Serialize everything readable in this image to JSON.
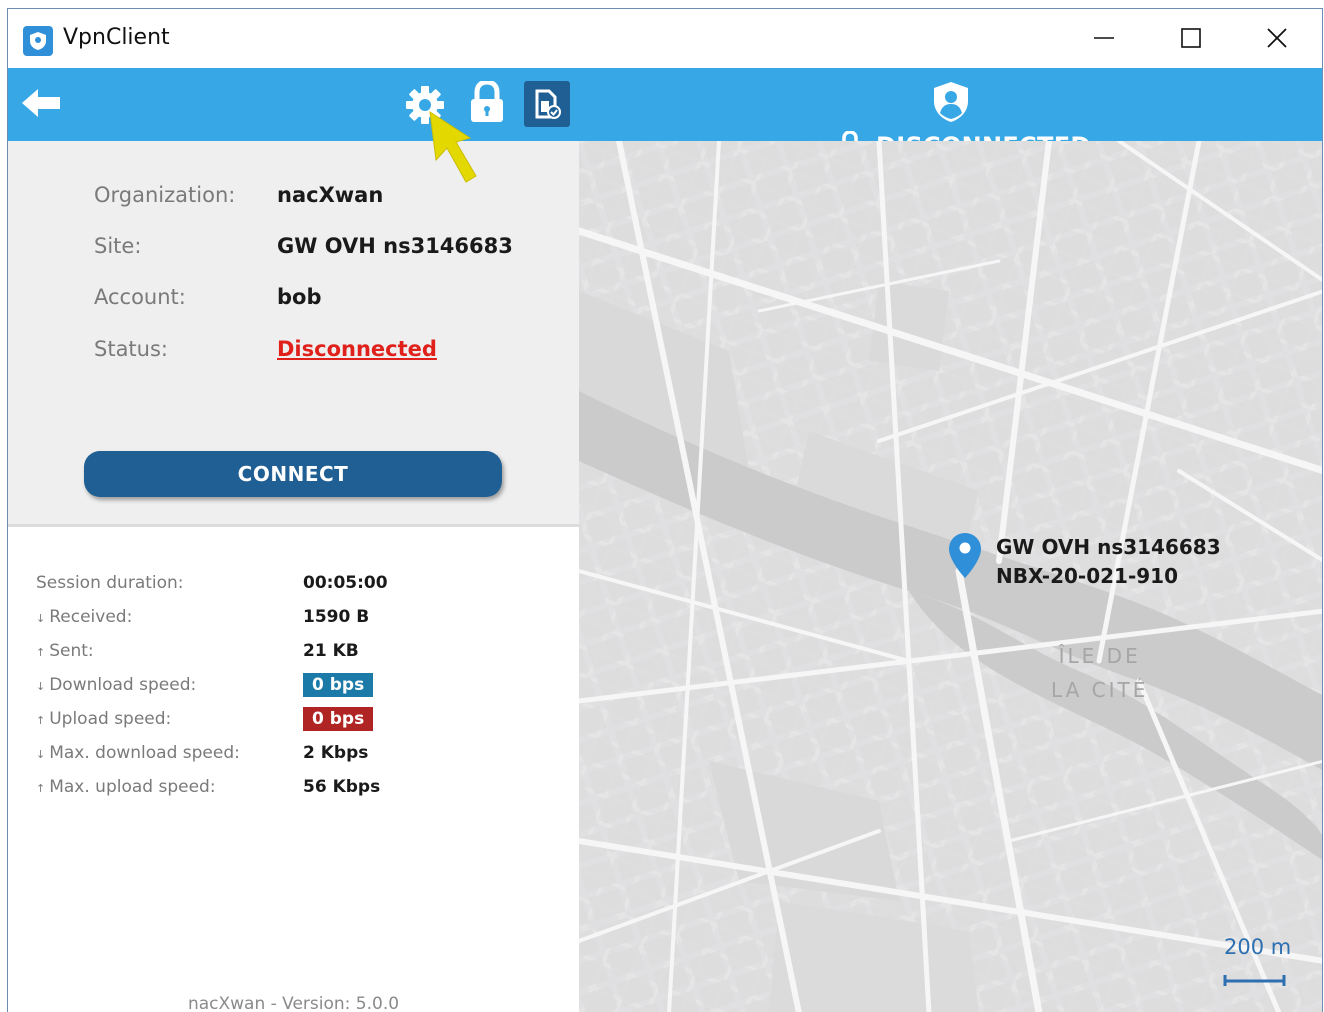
{
  "window": {
    "title": "VpnClient",
    "icon": "shield-app-icon",
    "controls": [
      "minimize-icon",
      "maximize-icon",
      "close-icon"
    ]
  },
  "toolbar": {
    "icons": [
      "back-arrow-icon",
      "gear-icon",
      "lock-icon",
      "sim-card-icon",
      "shield-user-icon"
    ],
    "status_label": "DISCONNECTED",
    "status_icon": "lock-icon"
  },
  "connection": {
    "organization_label": "Organization:",
    "organization_value": "nacXwan",
    "site_label": "Site:",
    "site_value": "GW OVH ns3146683",
    "account_label": "Account:",
    "account_value": "bob",
    "status_label": "Status:",
    "status_value": "Disconnected",
    "connect_label": "CONNECT"
  },
  "stats": {
    "session_label": "Session duration:",
    "session_value": "00:05:00",
    "received_label": "Received:",
    "received_value": "1590 B",
    "sent_label": "Sent:",
    "sent_value": "21 KB",
    "download_label": "Download speed:",
    "download_value": "0 bps",
    "upload_label": "Upload speed:",
    "upload_value": "0 bps",
    "max_download_label": "Max. download speed:",
    "max_download_value": "2 Kbps",
    "max_upload_label": "Max. upload speed:",
    "max_upload_value": "56 Kbps",
    "arrow_down": "↓",
    "arrow_up": "↑"
  },
  "footer": {
    "version": "nacXwan - Version: 5.0.0"
  },
  "map": {
    "marker_title": "GW OVH ns3146683",
    "marker_subtitle": "NBX-20-021-910",
    "place_line1": "ÎLE DE",
    "place_line2": "LA CITÉ",
    "scale_label": "200 m"
  },
  "colors": {
    "accent": "#37a7e6",
    "connect_button": "#1f5f93",
    "status_red": "#e0201a",
    "download_badge": "#1c7aa8",
    "upload_badge": "#b12424",
    "cursor": "#e3d800"
  }
}
